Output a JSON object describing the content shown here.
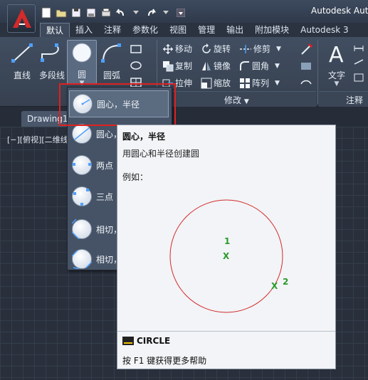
{
  "app": {
    "title": "Autodesk Aut"
  },
  "ribbon": {
    "tabs": [
      "默认",
      "插入",
      "注释",
      "参数化",
      "视图",
      "管理",
      "输出",
      "附加模块",
      "Autodesk 3"
    ],
    "draw_tools": [
      "直线",
      "多段线",
      "圆",
      "圆弧"
    ],
    "modify_tools": {
      "row1": [
        "移动",
        "旋转",
        "修剪"
      ],
      "row2": [
        "复制",
        "镜像",
        "圆角"
      ],
      "row3": [
        "拉伸",
        "缩放",
        "阵列"
      ]
    },
    "annotation_tool": "文字",
    "panels": {
      "modify": "修改",
      "annotation": "注释"
    }
  },
  "file_tab": "Drawing1",
  "viewport_label": "[−][俯视][二维线",
  "circle_dropdown": {
    "items": [
      "圆心，半径",
      "圆心，",
      "两点",
      "三点",
      "相切，",
      "相切，"
    ],
    "selected": "圆心，半径"
  },
  "tooltip": {
    "title": "圆心，半径",
    "description": "用圆心和半径创建圆",
    "example_label": "例如：",
    "figure": {
      "point1": "1",
      "point2": "2",
      "marker": "X"
    },
    "command": "CIRCLE",
    "help": "按 F1 键获得更多帮助"
  },
  "colors": {
    "highlight": "#e02020",
    "figure_circle": "#d42a2a",
    "figure_points": "#2a9a2a"
  }
}
